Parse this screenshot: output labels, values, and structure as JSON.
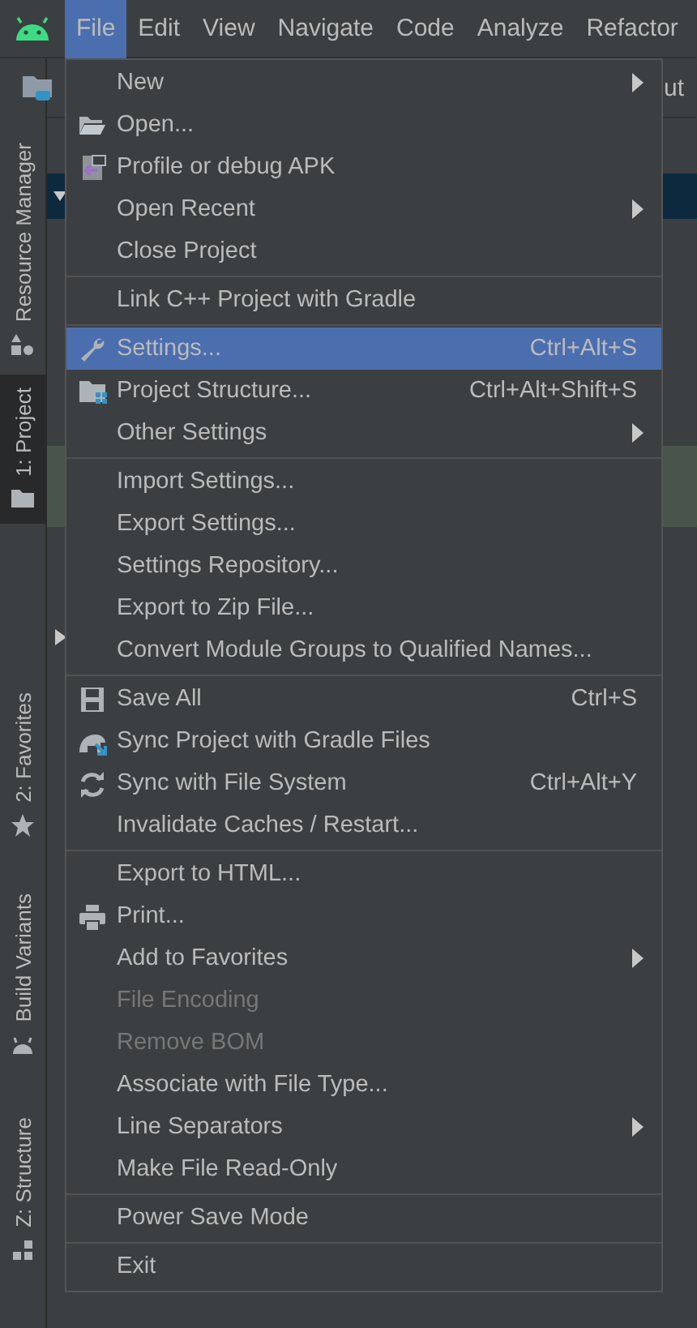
{
  "menubar": {
    "items": [
      {
        "label": "File",
        "selected": true
      },
      {
        "label": "Edit",
        "selected": false
      },
      {
        "label": "View",
        "selected": false
      },
      {
        "label": "Navigate",
        "selected": false
      },
      {
        "label": "Code",
        "selected": false
      },
      {
        "label": "Analyze",
        "selected": false
      },
      {
        "label": "Refactor",
        "selected": false
      }
    ]
  },
  "toolbar": {
    "right_text": "ut"
  },
  "tool_strip": [
    {
      "label": "Resource Manager",
      "selected": false
    },
    {
      "label": "1: Project",
      "selected": true
    },
    {
      "label": "2: Favorites",
      "selected": false
    },
    {
      "label": "Build Variants",
      "selected": false
    },
    {
      "label": "Z: Structure",
      "selected": false
    }
  ],
  "file_menu": {
    "groups": [
      [
        {
          "label": "New",
          "submenu": true,
          "disabled": false,
          "selected": false
        },
        {
          "label": "Open...",
          "submenu": false,
          "disabled": false,
          "selected": false
        },
        {
          "label": "Profile or debug APK",
          "submenu": false,
          "disabled": false,
          "selected": false
        },
        {
          "label": "Open Recent",
          "submenu": true,
          "disabled": false,
          "selected": false
        },
        {
          "label": "Close Project",
          "submenu": false,
          "disabled": false,
          "selected": false
        }
      ],
      [
        {
          "label": "Link C++ Project with Gradle",
          "submenu": false,
          "disabled": false,
          "selected": false
        }
      ],
      [
        {
          "label": "Settings...",
          "shortcut": "Ctrl+Alt+S",
          "submenu": false,
          "disabled": false,
          "selected": true
        },
        {
          "label": "Project Structure...",
          "shortcut": "Ctrl+Alt+Shift+S",
          "submenu": false,
          "disabled": false,
          "selected": false
        },
        {
          "label": "Other Settings",
          "submenu": true,
          "disabled": false,
          "selected": false
        }
      ],
      [
        {
          "label": "Import Settings...",
          "submenu": false,
          "disabled": false,
          "selected": false
        },
        {
          "label": "Export Settings...",
          "submenu": false,
          "disabled": false,
          "selected": false
        },
        {
          "label": "Settings Repository...",
          "submenu": false,
          "disabled": false,
          "selected": false
        },
        {
          "label": "Export to Zip File...",
          "submenu": false,
          "disabled": false,
          "selected": false
        },
        {
          "label": "Convert Module Groups to Qualified Names...",
          "submenu": false,
          "disabled": false,
          "selected": false
        }
      ],
      [
        {
          "label": "Save All",
          "shortcut": "Ctrl+S",
          "submenu": false,
          "disabled": false,
          "selected": false
        },
        {
          "label": "Sync Project with Gradle Files",
          "submenu": false,
          "disabled": false,
          "selected": false
        },
        {
          "label": "Sync with File System",
          "shortcut": "Ctrl+Alt+Y",
          "submenu": false,
          "disabled": false,
          "selected": false
        },
        {
          "label": "Invalidate Caches / Restart...",
          "submenu": false,
          "disabled": false,
          "selected": false
        }
      ],
      [
        {
          "label": "Export to HTML...",
          "submenu": false,
          "disabled": false,
          "selected": false
        },
        {
          "label": "Print...",
          "submenu": false,
          "disabled": false,
          "selected": false
        },
        {
          "label": "Add to Favorites",
          "submenu": true,
          "disabled": false,
          "selected": false
        },
        {
          "label": "File Encoding",
          "submenu": false,
          "disabled": true,
          "selected": false
        },
        {
          "label": "Remove BOM",
          "submenu": false,
          "disabled": true,
          "selected": false
        },
        {
          "label": "Associate with File Type...",
          "submenu": false,
          "disabled": false,
          "selected": false
        },
        {
          "label": "Line Separators",
          "submenu": true,
          "disabled": false,
          "selected": false
        },
        {
          "label": "Make File Read-Only",
          "submenu": false,
          "disabled": false,
          "selected": false
        }
      ],
      [
        {
          "label": "Power Save Mode",
          "submenu": false,
          "disabled": false,
          "selected": false
        }
      ],
      [
        {
          "label": "Exit",
          "submenu": false,
          "disabled": false,
          "selected": false
        }
      ]
    ]
  }
}
